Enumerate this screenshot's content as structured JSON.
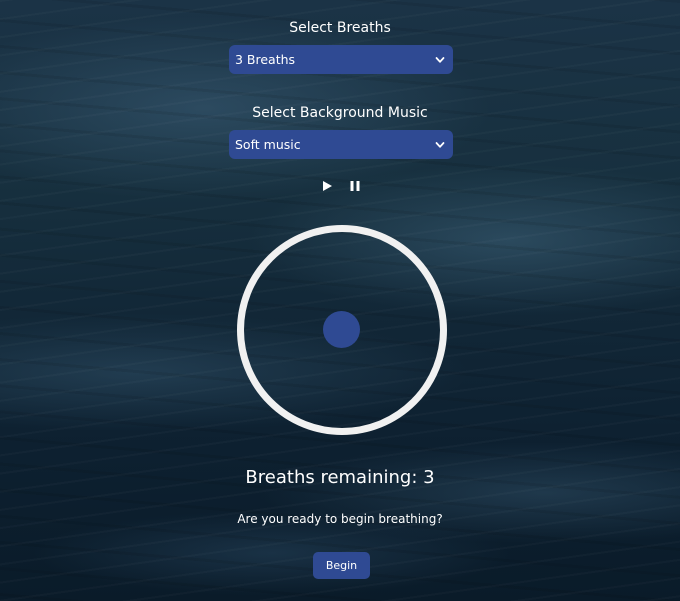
{
  "breaths_section": {
    "label": "Select Breaths",
    "selected": "3 Breaths"
  },
  "music_section": {
    "label": "Select Background Music",
    "selected": "Soft music"
  },
  "audio_controls": {
    "play_icon": "play-icon",
    "pause_icon": "pause-icon"
  },
  "status": {
    "remaining_text": "Breaths remaining: 3",
    "prompt": "Are you ready to begin breathing?"
  },
  "begin_button": {
    "label": "Begin"
  },
  "colors": {
    "accent": "#2f4a93",
    "ring": "#f1f1f1",
    "background": "#112636"
  }
}
